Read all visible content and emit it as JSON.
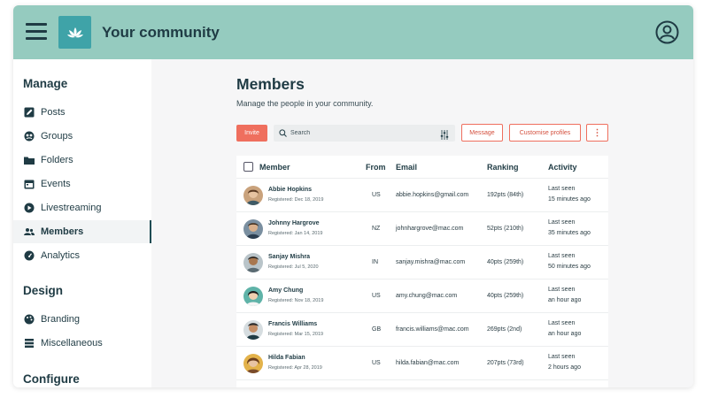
{
  "header": {
    "title": "Your community"
  },
  "sidebar": {
    "sections": [
      {
        "title": "Manage"
      },
      {
        "title": "Design"
      },
      {
        "title": "Configure"
      }
    ],
    "items": [
      {
        "label": "Posts",
        "icon": "edit-icon"
      },
      {
        "label": "Groups",
        "icon": "groups-icon"
      },
      {
        "label": "Folders",
        "icon": "folder-icon"
      },
      {
        "label": "Events",
        "icon": "calendar-icon"
      },
      {
        "label": "Livestreaming",
        "icon": "play-icon"
      },
      {
        "label": "Members",
        "icon": "members-icon",
        "active": true
      },
      {
        "label": "Analytics",
        "icon": "gauge-icon"
      },
      {
        "label": "Branding",
        "icon": "palette-icon"
      },
      {
        "label": "Miscellaneous",
        "icon": "layers-icon"
      }
    ]
  },
  "main": {
    "title": "Members",
    "subtitle": "Manage the people in your community.",
    "toolbar": {
      "invite_label": "Invite",
      "search_placeholder": "Search",
      "message_label": "Message",
      "customise_label": "Customise profiles",
      "more_label": "⋮"
    },
    "table": {
      "columns": [
        "Member",
        "From",
        "Email",
        "Ranking",
        "Activity"
      ],
      "rows": [
        {
          "name": "Abbie Hopkins",
          "registered": "Registered: Dec 18, 2019",
          "from": "US",
          "email": "abbie.hopkins@gmail.com",
          "ranking": "192pts (84th)",
          "activity1": "Last seen",
          "activity2": "15 minutes ago"
        },
        {
          "name": "Johnny Hargrove",
          "registered": "Registered: Jan 14, 2019",
          "from": "NZ",
          "email": "johnhargrove@mac.com",
          "ranking": "52pts (210th)",
          "activity1": "Last seen",
          "activity2": "35 minutes ago"
        },
        {
          "name": "Sanjay Mishra",
          "registered": "Registered: Jul 5, 2020",
          "from": "IN",
          "email": "sanjay.mishra@mac.com",
          "ranking": "40pts (259th)",
          "activity1": "Last seen",
          "activity2": "50 minutes ago"
        },
        {
          "name": "Amy Chung",
          "registered": "Registered: Nov 18, 2019",
          "from": "US",
          "email": "amy.chung@mac.com",
          "ranking": "40pts (259th)",
          "activity1": "Last seen",
          "activity2": "an hour ago"
        },
        {
          "name": "Francis Williams",
          "registered": "Registered: Mar 15, 2019",
          "from": "GB",
          "email": "francis.williams@mac.com",
          "ranking": "269pts (2nd)",
          "activity1": "Last seen",
          "activity2": "an hour ago"
        },
        {
          "name": "Hilda Fabian",
          "registered": "Registered: Apr 28, 2019",
          "from": "US",
          "email": "hilda.fabian@mac.com",
          "ranking": "207pts (73rd)",
          "activity1": "Last seen",
          "activity2": "2 hours ago"
        }
      ]
    }
  },
  "colors": {
    "header_bg": "#95cbbf",
    "logo_bg": "#3fa3a8",
    "accent": "#ef6f5e",
    "text_dark": "#1f3b44"
  }
}
